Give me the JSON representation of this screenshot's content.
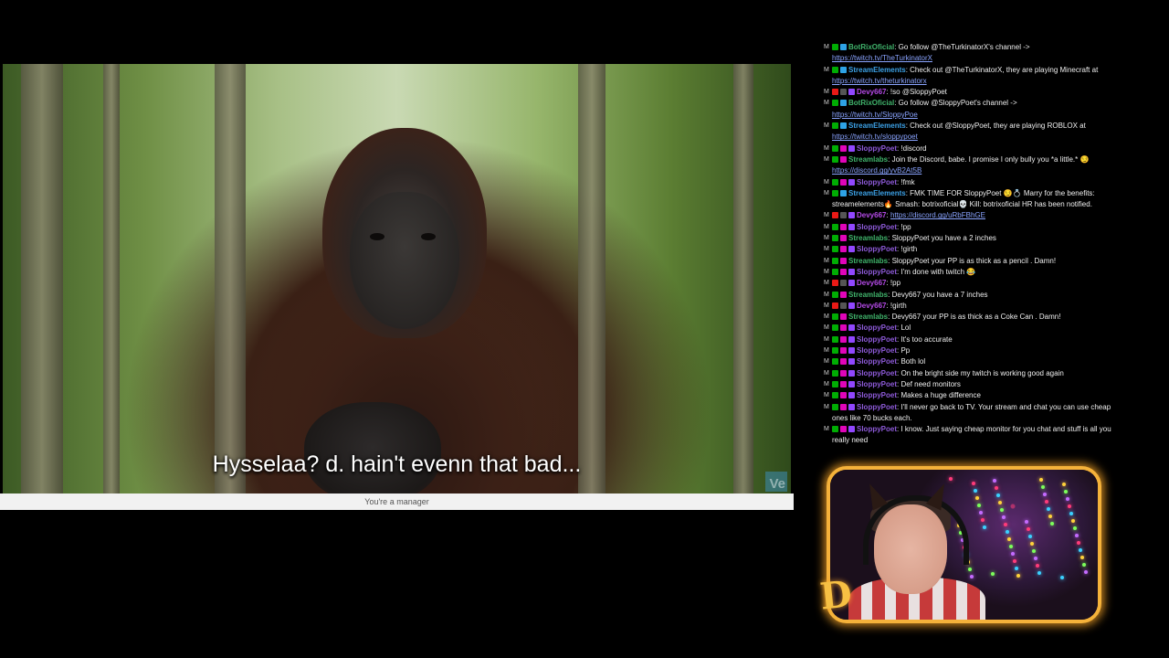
{
  "video": {
    "subtitle": "Hysselaa? d. hain't evenn that bad...",
    "watermark": "Ve"
  },
  "status_bar": {
    "text": "You're a manager"
  },
  "chat": {
    "messages": [
      {
        "user": "BotRixOficial",
        "color": "#40b36b",
        "badges": [
          "b-mod",
          "b-bot"
        ],
        "text": ": Go follow @TheTurkinatorX's channel ->",
        "link": "https://twitch.tv/TheTurkinatorX"
      },
      {
        "user": "StreamElements",
        "color": "#3ca1e6",
        "badges": [
          "b-mod",
          "b-bot"
        ],
        "text": ": Check out @TheTurkinatorX, they are playing Minecraft at",
        "link": "https://twitch.tv/theturkinatorx"
      },
      {
        "user": "Devy667",
        "color": "#b44ae6",
        "badges": [
          "b-red",
          "b-gry",
          "b-sub"
        ],
        "text": ": !so @SloppyPoet",
        "link": ""
      },
      {
        "user": "BotRixOficial",
        "color": "#40b36b",
        "badges": [
          "b-mod",
          "b-bot"
        ],
        "text": ": Go follow @SloppyPoet's channel ->",
        "link": "https://twitch.tv/SloppyPoe"
      },
      {
        "user": "StreamElements",
        "color": "#3ca1e6",
        "badges": [
          "b-mod",
          "b-bot"
        ],
        "text": ": Check out @SloppyPoet, they are playing ROBLOX at",
        "link": "https://twitch.tv/sloppypoet"
      },
      {
        "user": "SloppyPoet",
        "color": "#8d5ad8",
        "badges": [
          "b-mod",
          "b-vip",
          "b-sub"
        ],
        "text": ": !discord",
        "link": ""
      },
      {
        "user": "Streamlabs",
        "color": "#40b36b",
        "badges": [
          "b-mod",
          "b-vip"
        ],
        "text": ": Join the Discord, babe. I promise I only bully you *a little.* 😏",
        "link": "https://discord.gg/yvB2At5B"
      },
      {
        "user": "SloppyPoet",
        "color": "#8d5ad8",
        "badges": [
          "b-mod",
          "b-vip",
          "b-sub"
        ],
        "text": ": !fmk",
        "link": ""
      },
      {
        "user": "StreamElements",
        "color": "#3ca1e6",
        "badges": [
          "b-mod",
          "b-bot"
        ],
        "text": ": FMK TIME FOR SloppyPoet 😏💍 Marry for the benefits: streamelements🔥 Smash: botrixoficial💀 Kill: botrixoficial HR has been notified.",
        "link": ""
      },
      {
        "user": "Devy667",
        "color": "#b44ae6",
        "badges": [
          "b-red",
          "b-gry",
          "b-sub"
        ],
        "text": ": ",
        "link": "https://discord.gg/uRbFBhGE"
      },
      {
        "user": "SloppyPoet",
        "color": "#8d5ad8",
        "badges": [
          "b-mod",
          "b-vip",
          "b-sub"
        ],
        "text": ": !pp",
        "link": ""
      },
      {
        "user": "Streamlabs",
        "color": "#40b36b",
        "badges": [
          "b-mod",
          "b-vip"
        ],
        "text": ": SloppyPoet you have a 2 inches",
        "link": ""
      },
      {
        "user": "SloppyPoet",
        "color": "#8d5ad8",
        "badges": [
          "b-mod",
          "b-vip",
          "b-sub"
        ],
        "text": ": !girth",
        "link": ""
      },
      {
        "user": "Streamlabs",
        "color": "#40b36b",
        "badges": [
          "b-mod",
          "b-vip"
        ],
        "text": ": SloppyPoet your PP is as thick as a pencil . Damn!",
        "link": ""
      },
      {
        "user": "SloppyPoet",
        "color": "#8d5ad8",
        "badges": [
          "b-mod",
          "b-vip",
          "b-sub"
        ],
        "text": ": I'm done with twitch 😂",
        "link": ""
      },
      {
        "user": "Devy667",
        "color": "#b44ae6",
        "badges": [
          "b-red",
          "b-gry",
          "b-sub"
        ],
        "text": ": !pp",
        "link": ""
      },
      {
        "user": "Streamlabs",
        "color": "#40b36b",
        "badges": [
          "b-mod",
          "b-vip"
        ],
        "text": ": Devy667 you have a 7 inches",
        "link": ""
      },
      {
        "user": "Devy667",
        "color": "#b44ae6",
        "badges": [
          "b-red",
          "b-gry",
          "b-sub"
        ],
        "text": ": !girth",
        "link": ""
      },
      {
        "user": "Streamlabs",
        "color": "#40b36b",
        "badges": [
          "b-mod",
          "b-vip"
        ],
        "text": ": Devy667 your PP is as thick as a Coke Can . Damn!",
        "link": ""
      },
      {
        "user": "SloppyPoet",
        "color": "#8d5ad8",
        "badges": [
          "b-mod",
          "b-vip",
          "b-sub"
        ],
        "text": ": Lol",
        "link": ""
      },
      {
        "user": "SloppyPoet",
        "color": "#8d5ad8",
        "badges": [
          "b-mod",
          "b-vip",
          "b-sub"
        ],
        "text": ": It's too accurate",
        "link": ""
      },
      {
        "user": "SloppyPoet",
        "color": "#8d5ad8",
        "badges": [
          "b-mod",
          "b-vip",
          "b-sub"
        ],
        "text": ": Pp",
        "link": ""
      },
      {
        "user": "SloppyPoet",
        "color": "#8d5ad8",
        "badges": [
          "b-mod",
          "b-vip",
          "b-sub"
        ],
        "text": ": Both lol",
        "link": ""
      },
      {
        "user": "SloppyPoet",
        "color": "#8d5ad8",
        "badges": [
          "b-mod",
          "b-vip",
          "b-sub"
        ],
        "text": ": On the bright side my twitch is working good again",
        "link": ""
      },
      {
        "user": "SloppyPoet",
        "color": "#8d5ad8",
        "badges": [
          "b-mod",
          "b-vip",
          "b-sub"
        ],
        "text": ": Def need monitors",
        "link": ""
      },
      {
        "user": "SloppyPoet",
        "color": "#8d5ad8",
        "badges": [
          "b-mod",
          "b-vip",
          "b-sub"
        ],
        "text": ": Makes a huge difference",
        "link": ""
      },
      {
        "user": "SloppyPoet",
        "color": "#8d5ad8",
        "badges": [
          "b-mod",
          "b-vip",
          "b-sub"
        ],
        "text": ": I'll never go back to TV. Your stream and chat you can use cheap ones like 70 bucks each.",
        "link": ""
      },
      {
        "user": "SloppyPoet",
        "color": "#8d5ad8",
        "badges": [
          "b-mod",
          "b-vip",
          "b-sub"
        ],
        "text": ": I know. Just saying cheap monitor for you chat and stuff is all you really need",
        "link": ""
      }
    ]
  },
  "webcam": {
    "logo": "D"
  }
}
